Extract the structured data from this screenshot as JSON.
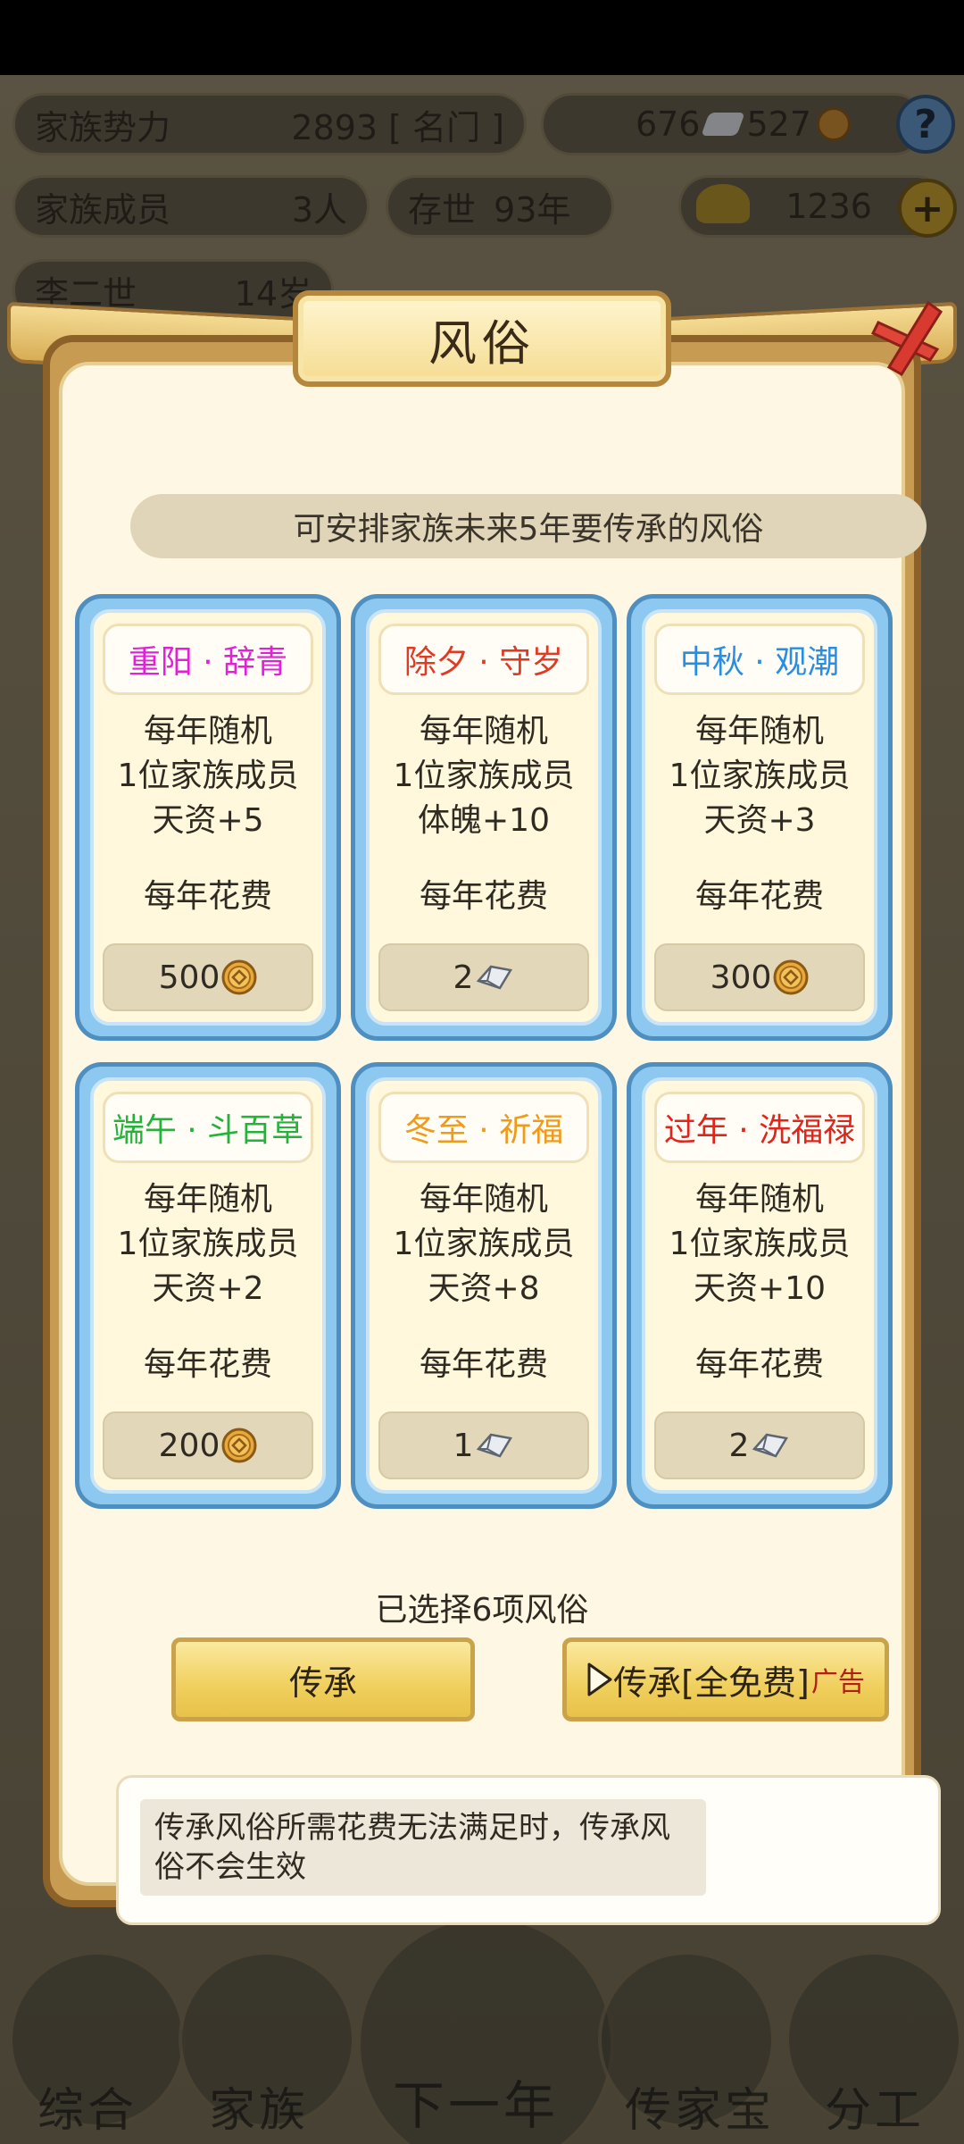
{
  "background": {
    "family_power_label": "家族势力",
    "family_power_value": "2893 [ 名门 ]",
    "silver_value": "676",
    "coin_value": "527",
    "help_icon": "?",
    "family_members_label": "家族成员",
    "family_members_value": "3人",
    "existence_label": "存世",
    "existence_value": "93年",
    "gold_value": "1236",
    "add_icon": "+",
    "member_name": "李二世",
    "member_age": "14岁",
    "nav": [
      "综合",
      "家族",
      "下一年",
      "传家宝",
      "分工"
    ]
  },
  "modal": {
    "title": "风俗",
    "subtitle": "可安排家族未来5年要传承的风俗",
    "customs": [
      {
        "name": "重阳 · 辞青",
        "color": "#e021d7",
        "line1": "每年随机",
        "line2": "1位家族成员",
        "effect": "天资+5",
        "cost_label": "每年花费",
        "cost": "500",
        "currency": "coin-icon"
      },
      {
        "name": "除夕 · 守岁",
        "color": "#e03a25",
        "line1": "每年随机",
        "line2": "1位家族成员",
        "effect": "体魄+10",
        "cost_label": "每年花费",
        "cost": "2",
        "currency": "silver-ingot-icon"
      },
      {
        "name": "中秋 · 观潮",
        "color": "#2a8ee0",
        "line1": "每年随机",
        "line2": "1位家族成员",
        "effect": "天资+3",
        "cost_label": "每年花费",
        "cost": "300",
        "currency": "coin-icon"
      },
      {
        "name": "端午 · 斗百草",
        "color": "#23b33a",
        "line1": "每年随机",
        "line2": "1位家族成员",
        "effect": "天资+2",
        "cost_label": "每年花费",
        "cost": "200",
        "currency": "coin-icon"
      },
      {
        "name": "冬至 · 祈福",
        "color": "#f09a1a",
        "line1": "每年随机",
        "line2": "1位家族成员",
        "effect": "天资+8",
        "cost_label": "每年花费",
        "cost": "1",
        "currency": "silver-ingot-icon"
      },
      {
        "name": "过年 · 洗福禄",
        "color": "#e0251d",
        "line1": "每年随机",
        "line2": "1位家族成员",
        "effect": "天资+10",
        "cost_label": "每年花费",
        "cost": "2",
        "currency": "silver-ingot-icon"
      }
    ],
    "selected_text": "已选择6项风俗",
    "inherit_button": "传承",
    "inherit_free_button": "传承[全免费]",
    "ad_tag": "广告",
    "note": "传承风俗所需花费无法满足时，传承风俗不会生效"
  }
}
